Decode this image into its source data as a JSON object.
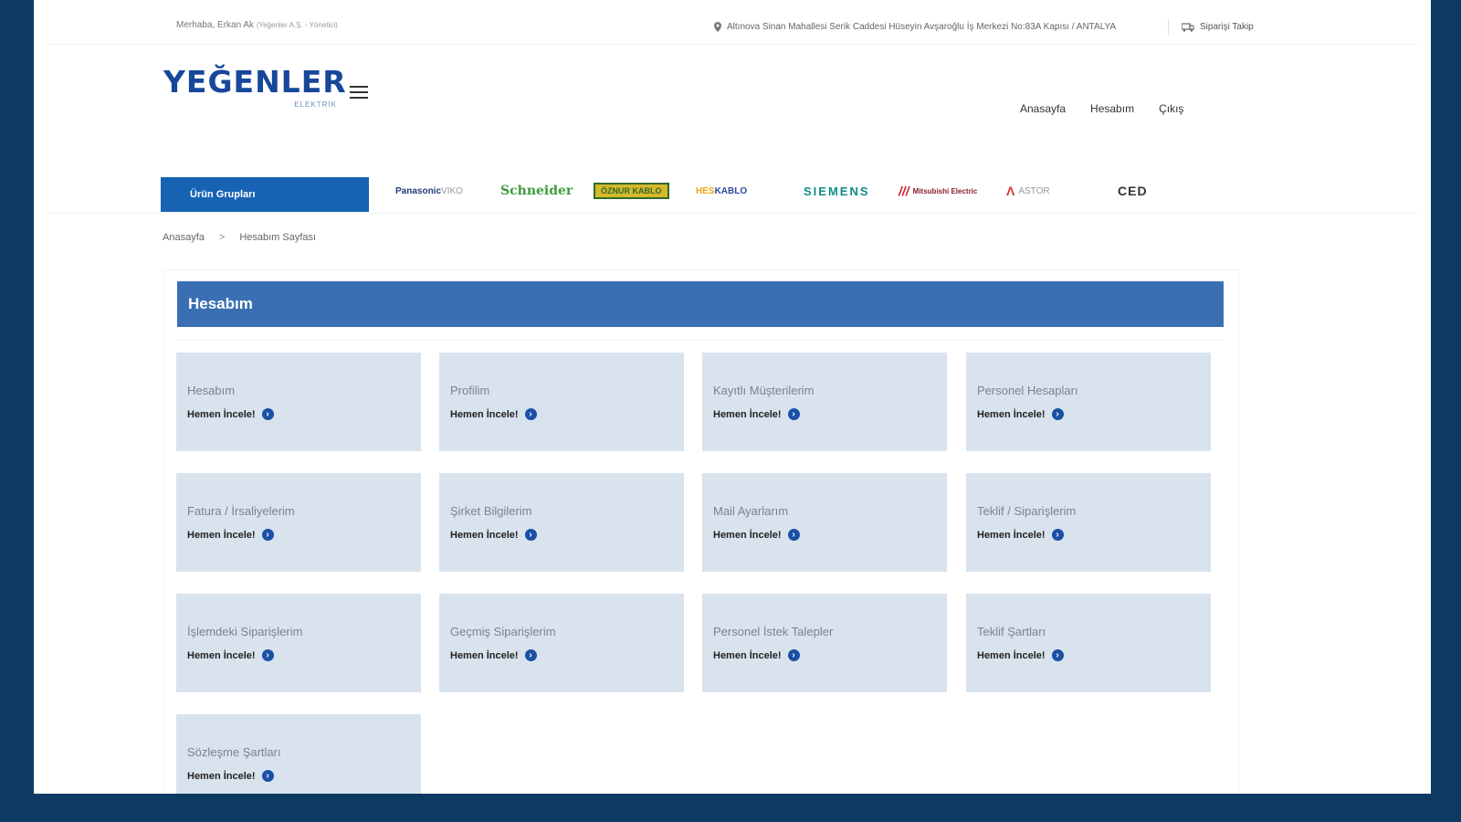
{
  "topbar": {
    "welcome": "Merhaba, Erkan Ak",
    "company": "(Yeğenler A.Ş. - Yönetici)",
    "address": "Altınova Sinan Mahallesi Serik Caddesi Hüseyin Avşaroğlu İş Merkezi No:83A Kapısı / ANTALYA",
    "cart": "Siparişi Takip"
  },
  "header": {
    "logo_text": "YEĞENLER",
    "logo_sub": "ELEKTRİK",
    "nav": [
      "Anasayfa",
      "Hesabım",
      "Çıkış"
    ]
  },
  "brand_bar": {
    "groups_label": "Ürün Grupları",
    "brands": {
      "panasonic": "Panasonic",
      "panasonic_sub": "VIKO",
      "schneider": "Schneider",
      "oznur": "ÖZNUR KABLO",
      "hes_a": "HES",
      "hes_b": "KABLO",
      "siemens": "SIEMENS",
      "mitsubishi": "Mitsubishi Electric",
      "astor": "ASTOR",
      "ced": "CED"
    }
  },
  "breadcrumb": {
    "home": "Anasayfa",
    "separator": ">",
    "current": "Hesabım Sayfası"
  },
  "account": {
    "title": "Hesabım",
    "link_label": "Hemen İncele!",
    "cards": [
      "Hesabım",
      "Profilim",
      "Kayıtlı Müşterilerim",
      "Personel Hesapları",
      "Fatura / İrsaliyelerim",
      "Şirket Bilgilerim",
      "Mail Ayarlarım",
      "Teklif / Siparişlerim",
      "İşlemdeki Siparişlerim",
      "Geçmiş Siparişlerim",
      "Personel İstek Talepler",
      "Teklif Şartları",
      "Sözleşme Şartları"
    ]
  },
  "colors": {
    "background_frame": "#0d3a63",
    "header_bar": "#3a6fb4",
    "button": "#1763b3",
    "card": "#d9e3ee"
  }
}
